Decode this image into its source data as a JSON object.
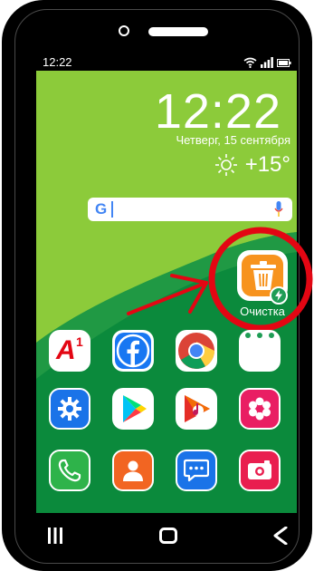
{
  "status_bar": {
    "time": "12:22",
    "icons": [
      "wifi-icon",
      "signal-icon",
      "battery-icon"
    ]
  },
  "clock_widget": {
    "time": "12:22",
    "date": "Четверг, 15 сентября",
    "temperature": "+15°",
    "weather_icon": "sun-icon"
  },
  "search_widget": {
    "logo": "G",
    "icons": [
      "google-logo-icon",
      "mic-icon"
    ]
  },
  "highlighted_app": {
    "label": "Очистка",
    "icon": "trash-bin-icon",
    "badge_icon": "lightning-bolt-icon",
    "annotation_color": "#e30613"
  },
  "app_grid": [
    [
      "a1-icon",
      "facebook-icon",
      "chrome-icon",
      "dots-app-icon"
    ],
    [
      "settings-icon",
      "play-store-icon",
      "music-player-icon",
      "gallery-flower-icon"
    ],
    [
      "phone-icon",
      "contacts-icon",
      "messages-icon",
      "camera-icon"
    ]
  ],
  "nav_bar": {
    "buttons": [
      "recent-apps-icon",
      "home-icon",
      "back-icon"
    ]
  },
  "colors": {
    "wallpaper_light": "#8ccb3a",
    "wallpaper_dark": "#0b8a3c",
    "accent_red": "#e30613",
    "cleaner_orange": "#f7931e"
  }
}
